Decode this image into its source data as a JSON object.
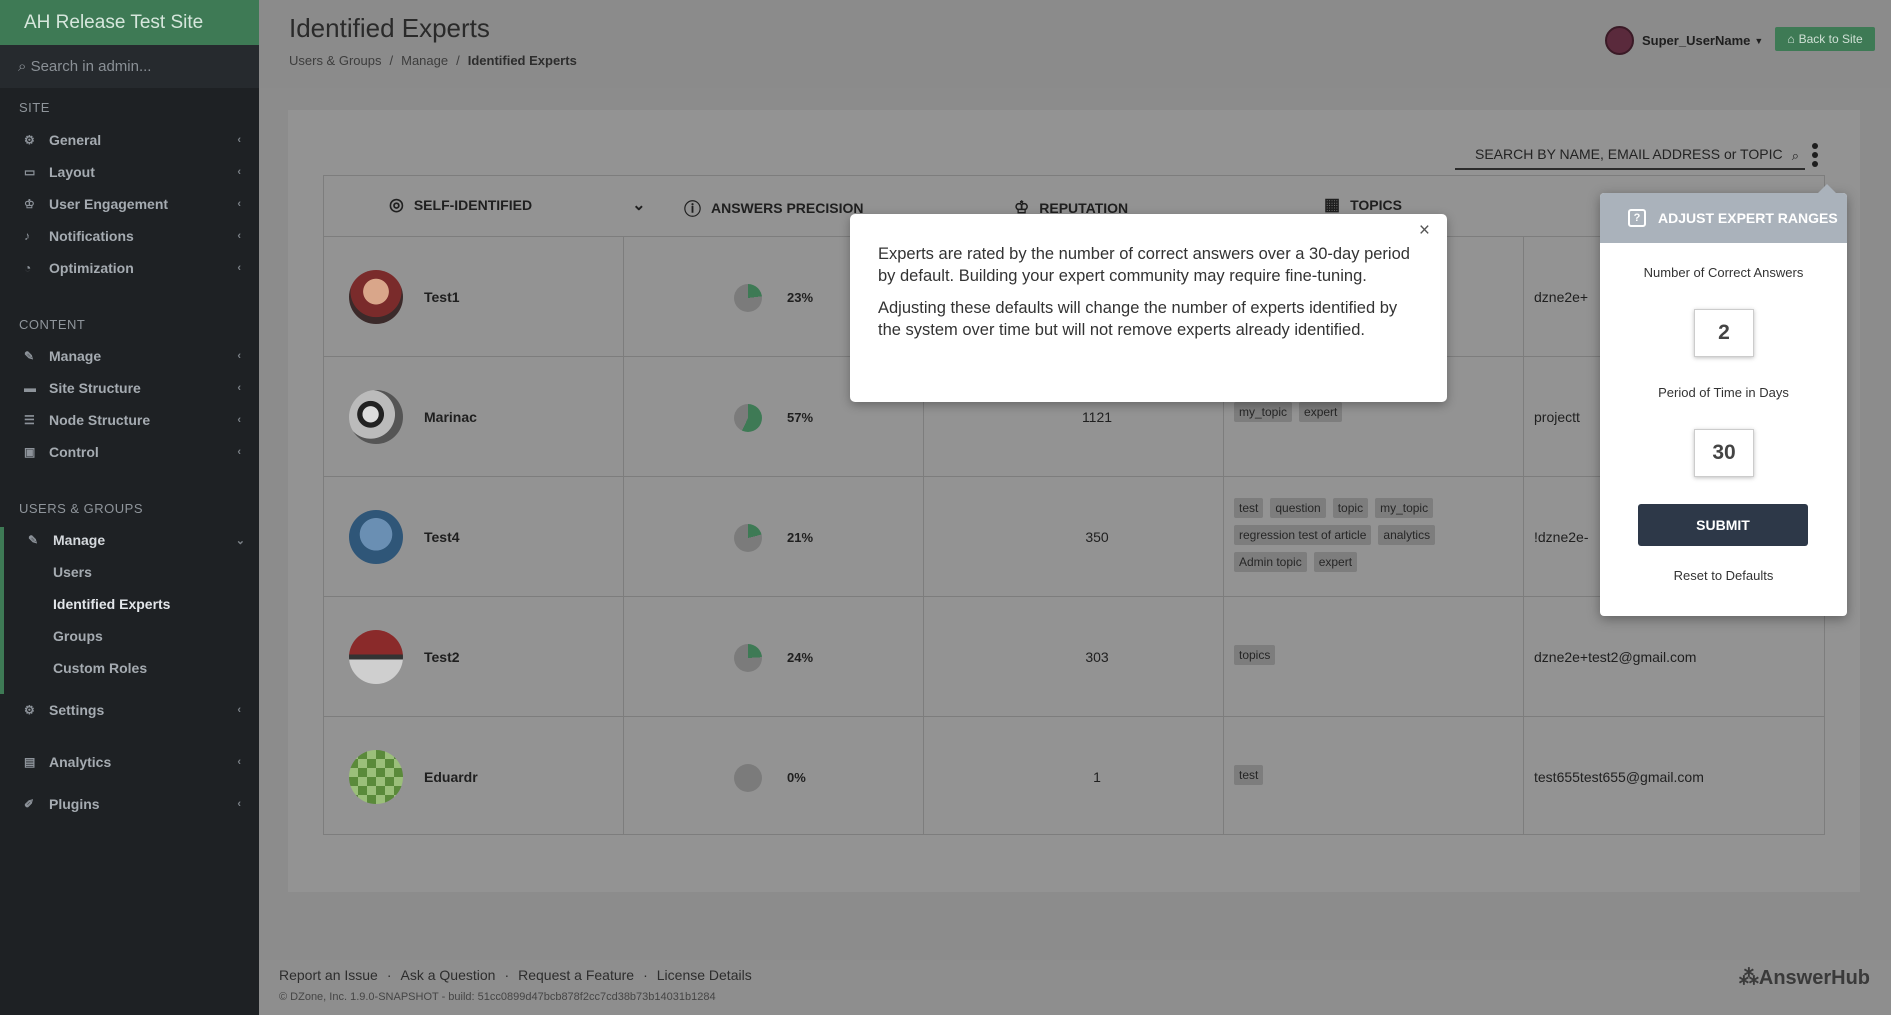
{
  "app": {
    "brand": "AH Release Test Site",
    "search_placeholder": "Search in admin..."
  },
  "sidebar": {
    "site_label": "SITE",
    "site_items": [
      {
        "label": "General",
        "icon": "cogs-icon"
      },
      {
        "label": "Layout",
        "icon": "monitor-icon"
      },
      {
        "label": "User Engagement",
        "icon": "trophy-icon"
      },
      {
        "label": "Notifications",
        "icon": "bell-icon"
      },
      {
        "label": "Optimization",
        "icon": "dashboard-icon"
      }
    ],
    "content_label": "CONTENT",
    "content_items": [
      {
        "label": "Manage",
        "icon": "wrench-icon"
      },
      {
        "label": "Site Structure",
        "icon": "folder-icon"
      },
      {
        "label": "Node Structure",
        "icon": "list-icon"
      },
      {
        "label": "Control",
        "icon": "lock-icon"
      }
    ],
    "users_label": "USERS & GROUPS",
    "users_manage": "Manage",
    "users_sub": [
      "Users",
      "Identified Experts",
      "Groups",
      "Custom Roles"
    ],
    "bottom_items": [
      {
        "label": "Settings",
        "icon": "gear-icon"
      },
      {
        "label": "Analytics",
        "icon": "chart-icon"
      },
      {
        "label": "Plugins",
        "icon": "plug-icon"
      }
    ]
  },
  "header": {
    "title": "Identified Experts",
    "breadcrumb": [
      "Users & Groups",
      "Manage",
      "Identified Experts"
    ],
    "username": "Super_UserName",
    "back_label": "Back to Site"
  },
  "search": {
    "placeholder": "SEARCH BY NAME, EMAIL ADDRESS or TOPIC"
  },
  "table": {
    "headers": [
      "SELF-IDENTIFIED",
      "ANSWERS PRECISION",
      "REPUTATION",
      "TOPICS"
    ],
    "rows": [
      {
        "name": "Test1",
        "precision": "23%",
        "pct": 23,
        "reputation": "",
        "topics": [],
        "email": "dzne2e+"
      },
      {
        "name": "Marinac",
        "precision": "57%",
        "pct": 57,
        "reputation": "1121",
        "topics": [
          "my_topic",
          "expert"
        ],
        "email": "projectt"
      },
      {
        "name": "Test4",
        "precision": "21%",
        "pct": 21,
        "reputation": "350",
        "topics": [
          "test",
          "question",
          "topic",
          "my_topic",
          "regression test of article",
          "analytics",
          "Admin topic",
          "expert"
        ],
        "email": "!dzne2e-"
      },
      {
        "name": "Test2",
        "precision": "24%",
        "pct": 24,
        "reputation": "303",
        "topics": [
          "topics"
        ],
        "email": "dzne2e+test2@gmail.com"
      },
      {
        "name": "Eduardr",
        "precision": "0%",
        "pct": 0,
        "reputation": "1",
        "topics": [
          "test"
        ],
        "email": "test655test655@gmail.com"
      }
    ]
  },
  "modal": {
    "p1": "Experts are rated by the number of correct answers over a 30-day period by default. Building your expert community may require fine-tuning.",
    "p2": "Adjusting these defaults will change the number of experts identified by the system over time but will not remove experts already identified.",
    "close": "×"
  },
  "popover": {
    "title": "ADJUST EXPERT RANGES",
    "correct_label": "Number of Correct Answers",
    "correct_value": "2",
    "days_label": "Period of Time in Days",
    "days_value": "30",
    "submit": "SUBMIT",
    "reset": "Reset to Defaults"
  },
  "footer": {
    "links": [
      "Report an Issue",
      "Ask a Question",
      "Request a Feature",
      "License Details"
    ],
    "copyright": "© DZone, Inc. 1.9.0-SNAPSHOT - build: 51cc0899d47bcb878f2cc7cd38b73b14031b1284",
    "logo": "AnswerHub"
  },
  "colors": {
    "brand": "#3e7a55",
    "sidebar": "#1e2124",
    "submit": "#2d3848",
    "pie": "#3e7a55"
  }
}
